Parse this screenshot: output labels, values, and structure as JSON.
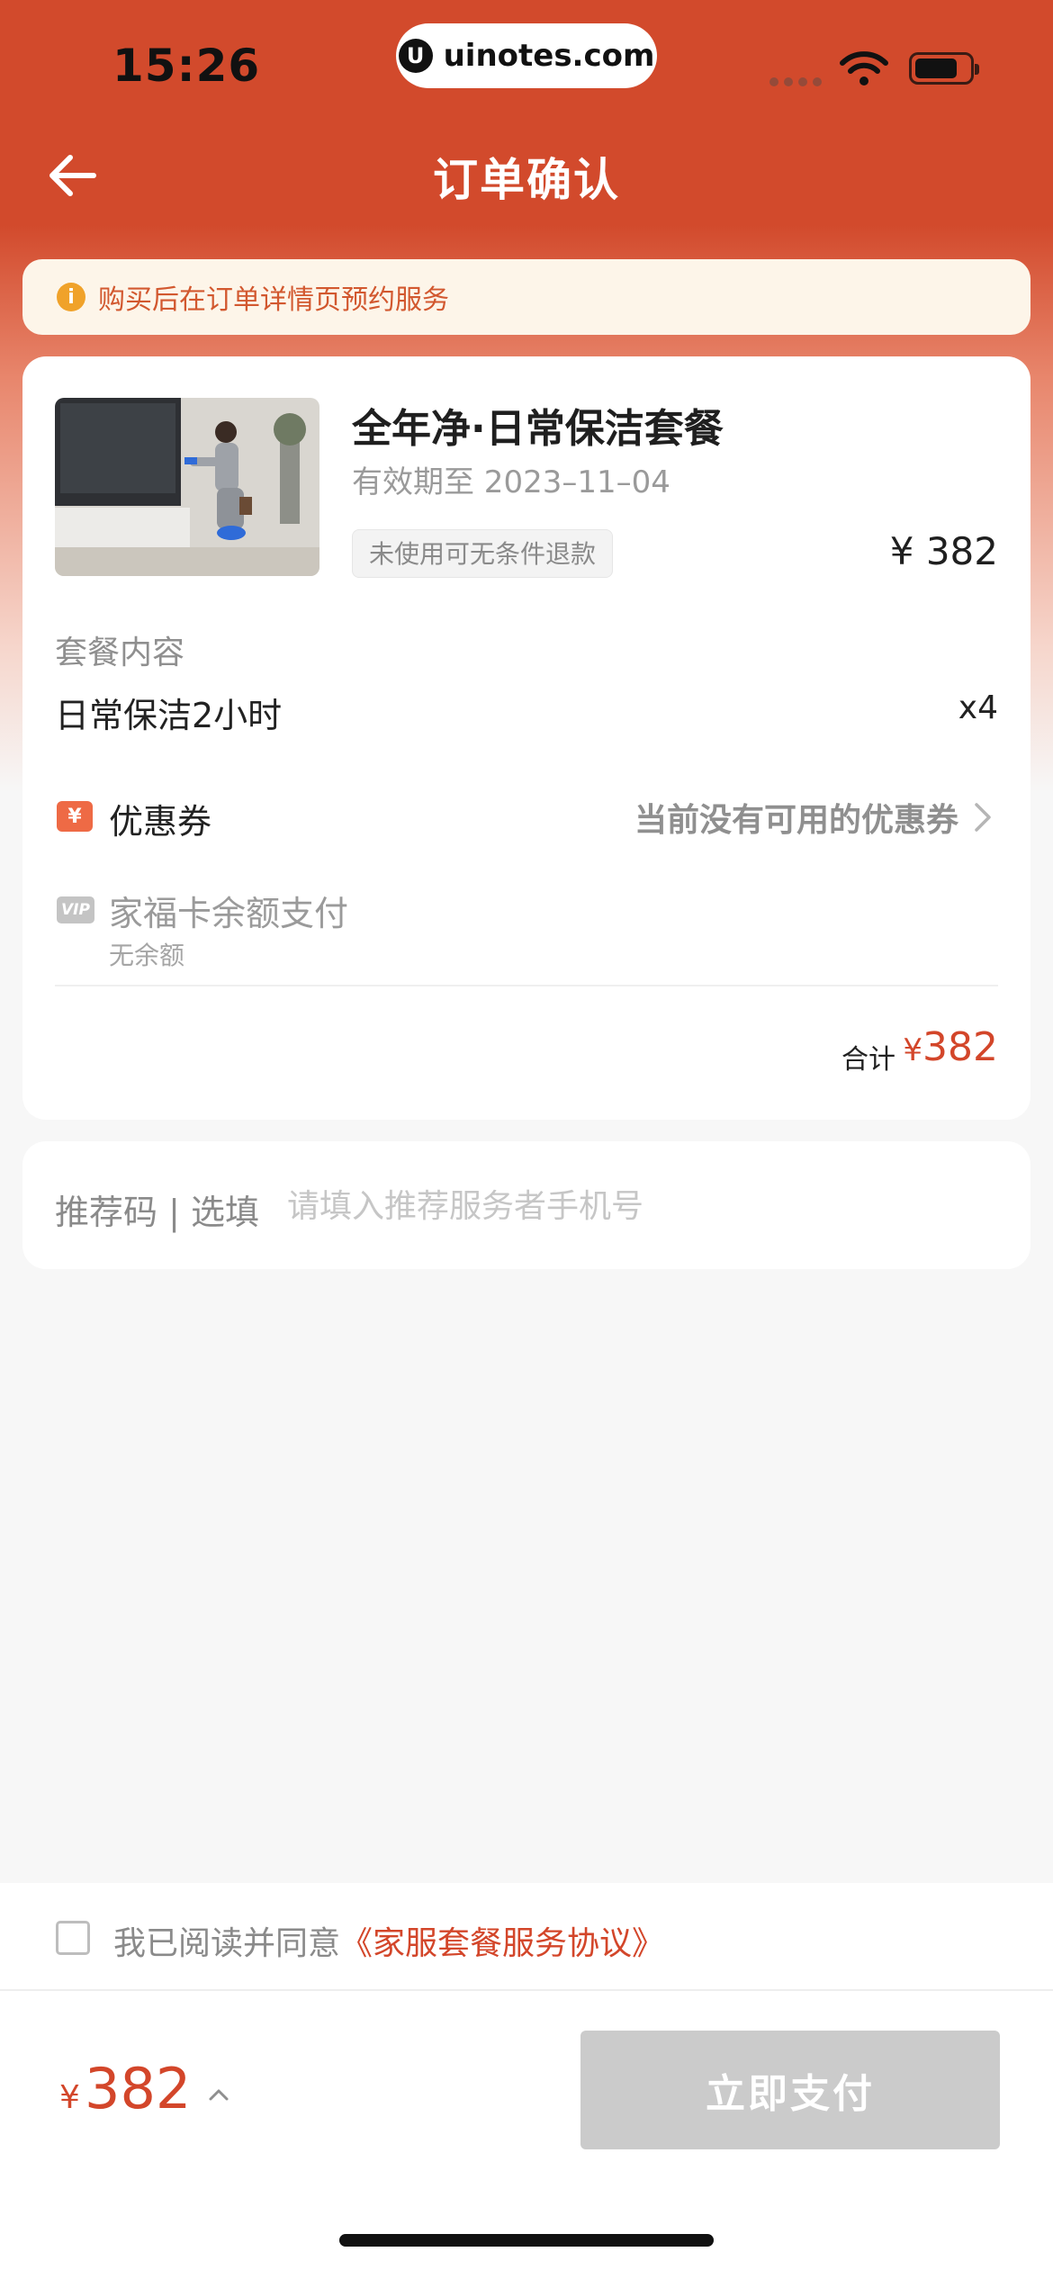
{
  "status_bar": {
    "time": "15:26",
    "url": "uinotes.com",
    "url_logo": "U"
  },
  "nav": {
    "back_icon": "arrow-left-icon",
    "title": "订单确认"
  },
  "notice": {
    "icon": "info-icon",
    "text": "购买后在订单详情页预约服务"
  },
  "product": {
    "title": "全年净·日常保洁套餐",
    "valid_until": "有效期至 2023–11–04",
    "refund_tag": "未使用可无条件退款",
    "price": "¥ 382"
  },
  "package": {
    "label": "套餐内容",
    "item": "日常保洁2小时",
    "quantity": "x4"
  },
  "coupon": {
    "icon": "coupon-icon",
    "icon_text": "¥",
    "label": "优惠券",
    "value": "当前没有可用的优惠券"
  },
  "card_balance": {
    "icon": "vip-icon",
    "icon_text": "VIP",
    "label": "家福卡余额支付",
    "sub": "无余额"
  },
  "total": {
    "label": "合计",
    "currency": "¥",
    "amount": "382"
  },
  "referral": {
    "label": "推荐码 | 选填",
    "placeholder": "请填入推荐服务者手机号",
    "value": ""
  },
  "agreement": {
    "checked": false,
    "text": "我已阅读并同意",
    "link": "《家服套餐服务协议》"
  },
  "bottom_bar": {
    "currency": "¥",
    "amount": "382",
    "pay_button": "立即支付"
  },
  "colors": {
    "brand": "#d24a2c",
    "price_red": "#d3462a",
    "button_disabled": "#cbcbcb",
    "notice_bg": "#fdf5e9"
  }
}
